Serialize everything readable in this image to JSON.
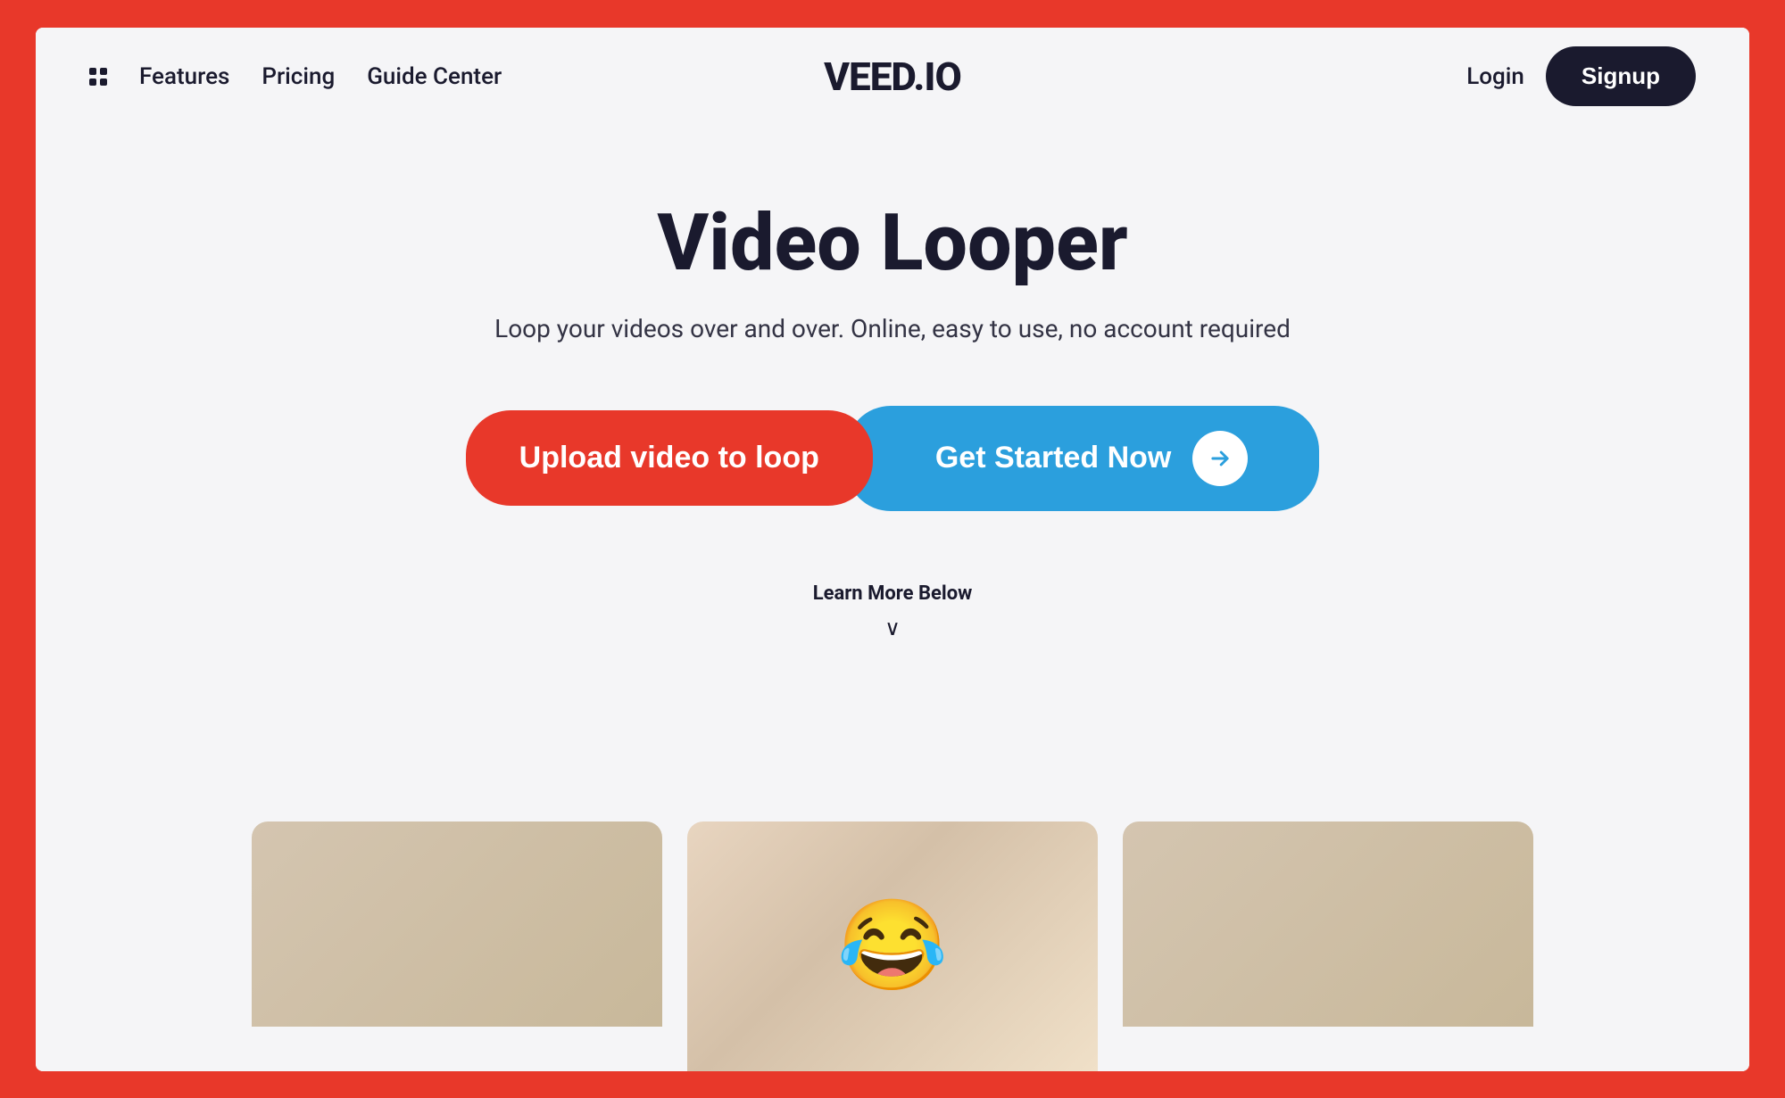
{
  "page": {
    "background_color": "#e8382a",
    "frame_bg": "#f5f5f7"
  },
  "nav": {
    "features_label": "Features",
    "pricing_label": "Pricing",
    "guide_label": "Guide Center",
    "brand": "VEED.IO",
    "login_label": "Login",
    "signup_label": "Signup"
  },
  "hero": {
    "title": "Video Looper",
    "subtitle": "Loop your videos over and over. Online, easy to use, no account required",
    "upload_btn": "Upload video to loop",
    "get_started_btn": "Get Started Now",
    "learn_more": "Learn More Below",
    "chevron": "∨"
  },
  "icons": {
    "grid": "grid-icon",
    "arrow_right": "→",
    "chevron_down": "∨"
  }
}
